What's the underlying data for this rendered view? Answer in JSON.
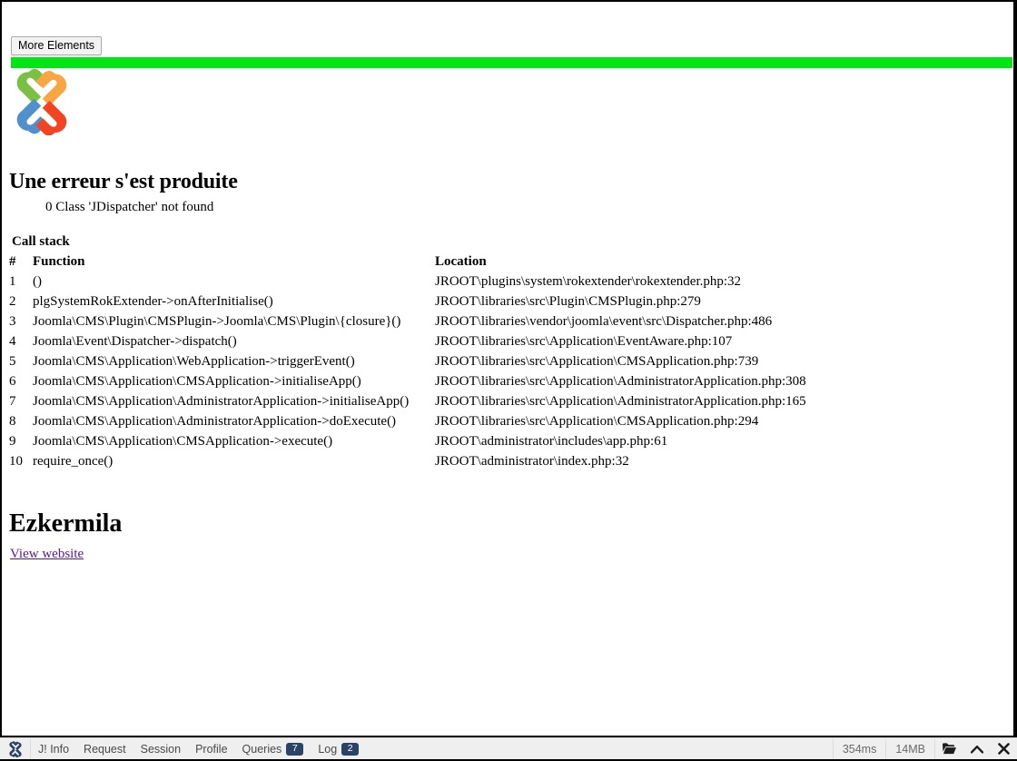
{
  "toolbar": {
    "more_elements_label": "More Elements"
  },
  "status_bar": {
    "color": "#00e612"
  },
  "logo": {
    "name": "joomla-logo",
    "colors": {
      "green": "#7ac143",
      "orange": "#f9a541",
      "blue": "#5091cd",
      "red": "#f44321"
    }
  },
  "error": {
    "heading": "Une erreur s'est produite",
    "message": "0 Class 'JDispatcher' not found"
  },
  "call_stack": {
    "title": "Call stack",
    "columns": {
      "num": "#",
      "function": "Function",
      "location": "Location"
    },
    "rows": [
      {
        "num": "1",
        "function": "()",
        "location": "JROOT\\plugins\\system\\rokextender\\rokextender.php:32"
      },
      {
        "num": "2",
        "function": "plgSystemRokExtender->onAfterInitialise()",
        "location": "JROOT\\libraries\\src\\Plugin\\CMSPlugin.php:279"
      },
      {
        "num": "3",
        "function": "Joomla\\CMS\\Plugin\\CMSPlugin->Joomla\\CMS\\Plugin\\{closure}()",
        "location": "JROOT\\libraries\\vendor\\joomla\\event\\src\\Dispatcher.php:486"
      },
      {
        "num": "4",
        "function": "Joomla\\Event\\Dispatcher->dispatch()",
        "location": "JROOT\\libraries\\src\\Application\\EventAware.php:107"
      },
      {
        "num": "5",
        "function": "Joomla\\CMS\\Application\\WebApplication->triggerEvent()",
        "location": "JROOT\\libraries\\src\\Application\\CMSApplication.php:739"
      },
      {
        "num": "6",
        "function": "Joomla\\CMS\\Application\\CMSApplication->initialiseApp()",
        "location": "JROOT\\libraries\\src\\Application\\AdministratorApplication.php:308"
      },
      {
        "num": "7",
        "function": "Joomla\\CMS\\Application\\AdministratorApplication->initialiseApp()",
        "location": "JROOT\\libraries\\src\\Application\\AdministratorApplication.php:165"
      },
      {
        "num": "8",
        "function": "Joomla\\CMS\\Application\\AdministratorApplication->doExecute()",
        "location": "JROOT\\libraries\\src\\Application\\CMSApplication.php:294"
      },
      {
        "num": "9",
        "function": "Joomla\\CMS\\Application\\CMSApplication->execute()",
        "location": "JROOT\\administrator\\includes\\app.php:61"
      },
      {
        "num": "10",
        "function": "require_once()",
        "location": "JROOT\\administrator\\index.php:32"
      }
    ]
  },
  "site": {
    "name": "Ezkermila",
    "view_website_link": "View website"
  },
  "debug_bar": {
    "items": [
      {
        "label": "J! Info",
        "badge": null
      },
      {
        "label": "Request",
        "badge": null
      },
      {
        "label": "Session",
        "badge": null
      },
      {
        "label": "Profile",
        "badge": null
      },
      {
        "label": "Queries",
        "badge": "7"
      },
      {
        "label": "Log",
        "badge": "2"
      }
    ],
    "time": "354ms",
    "memory": "14MB",
    "badge_color": "#2a4366",
    "background": "#efefef"
  }
}
